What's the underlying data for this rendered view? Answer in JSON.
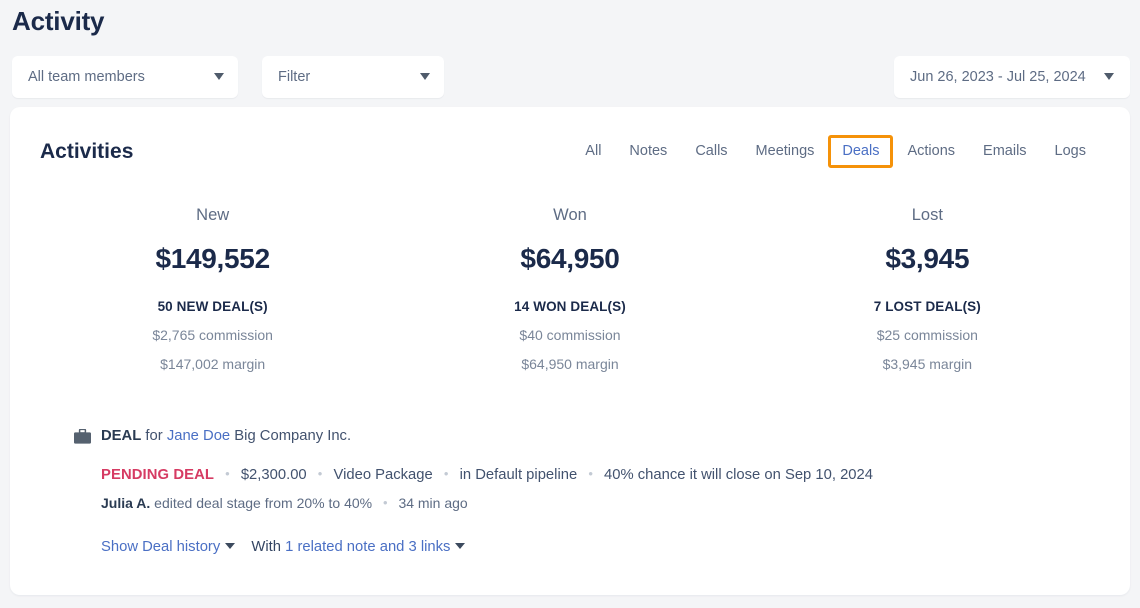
{
  "page": {
    "title": "Activity"
  },
  "toolbar": {
    "members_filter": {
      "value": "All team members",
      "icon": "chevron-down-icon"
    },
    "generic_filter": {
      "value": "Filter",
      "icon": "chevron-down-icon"
    },
    "date_range": {
      "value": "Jun 26, 2023 - Jul 25, 2024",
      "icon": "chevron-down-icon"
    }
  },
  "card": {
    "title": "Activities",
    "tabs": [
      {
        "label": "All",
        "active": false
      },
      {
        "label": "Notes",
        "active": false
      },
      {
        "label": "Calls",
        "active": false
      },
      {
        "label": "Meetings",
        "active": false
      },
      {
        "label": "Deals",
        "active": true
      },
      {
        "label": "Actions",
        "active": false
      },
      {
        "label": "Emails",
        "active": false
      },
      {
        "label": "Logs",
        "active": false
      }
    ],
    "stats": [
      {
        "label": "New",
        "amount": "$149,552",
        "count": "50 NEW DEAL(S)",
        "commission": "$2,765 commission",
        "margin": "$147,002 margin"
      },
      {
        "label": "Won",
        "amount": "$64,950",
        "count": "14 WON DEAL(S)",
        "commission": "$40 commission",
        "margin": "$64,950 margin"
      },
      {
        "label": "Lost",
        "amount": "$3,945",
        "count": "7 LOST DEAL(S)",
        "commission": "$25 commission",
        "margin": "$3,945 margin"
      }
    ],
    "activity": {
      "icon": "briefcase-icon",
      "type_label": "DEAL",
      "for_word": "for",
      "contact": "Jane Doe",
      "company": "Big Company Inc.",
      "status": "PENDING DEAL",
      "amount": "$2,300.00",
      "product": "Video Package",
      "pipeline": "in Default pipeline",
      "chance": "40% chance it will close on Sep 10, 2024",
      "actor": "Julia A.",
      "action": "edited deal stage from 20% to 40%",
      "time": "34 min ago",
      "history_link": "Show Deal history",
      "with_word": "With",
      "related_link": "1 related note and 3 links"
    }
  },
  "colors": {
    "accent_orange": "#f59209",
    "link_blue": "#4a6fc4",
    "pending_pink": "#d63b63",
    "heading_navy": "#1b2a4a",
    "page_bg": "#f4f5f7"
  }
}
